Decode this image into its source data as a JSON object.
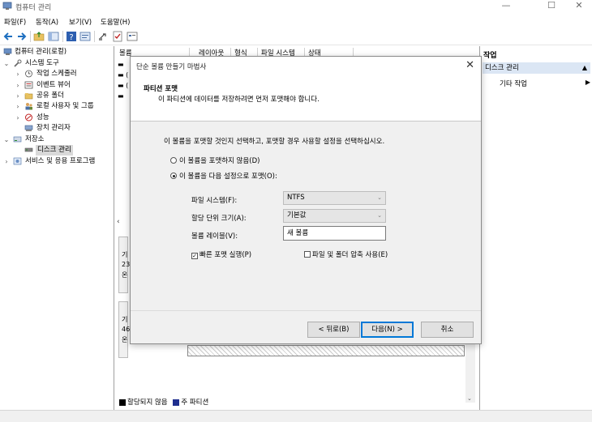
{
  "window": {
    "title": "컴퓨터 관리",
    "minimize": "—",
    "maximize": "☐",
    "close": "✕"
  },
  "menu": [
    "파일(F)",
    "동작(A)",
    "보기(V)",
    "도움말(H)"
  ],
  "toolbar_icons": [
    "back-icon",
    "forward-icon",
    "folder-up-icon",
    "show-tree-icon",
    "help-icon",
    "properties-icon",
    "connect-icon",
    "checklist-icon",
    "view-icon"
  ],
  "tree": {
    "root": "컴퓨터 관리(로컬)",
    "system_tools": "시스템 도구",
    "task_scheduler": "작업 스케줄러",
    "event_viewer": "이벤트 뷰어",
    "shared_folders": "공유 폴더",
    "local_users": "로컬 사용자 및 그룹",
    "performance": "성능",
    "device_manager": "장치 관리자",
    "storage": "저장소",
    "disk_management": "디스크 관리",
    "services": "서비스 및 응용 프로그램"
  },
  "columns": [
    "볼륨",
    "레이아웃",
    "형식",
    "파일 시스템",
    "상태"
  ],
  "legend": {
    "unallocated": "할당되지 않음",
    "primary": "주 파티션"
  },
  "disk_labels": [
    "기",
    "23",
    "온",
    "기",
    "46",
    "온"
  ],
  "actions": {
    "header": "작업",
    "section": "디스크 관리",
    "more": "기타 작업"
  },
  "dialog": {
    "title": "단순 볼륨 만들기 마법사",
    "header_title": "파티션 포맷",
    "header_sub": "이 파티션에 데이터를 저장하려면 먼저 포맷해야 합니다.",
    "instruction": "이 볼륨을 포맷할 것인지 선택하고, 포맷할 경우 사용할 설정을 선택하십시오.",
    "radio_no_format": "이 볼륨을 포맷하지 않음(D)",
    "radio_format": "이 볼륨을 다음 설정으로 포맷(O):",
    "fs_label": "파일 시스템(F):",
    "fs_value": "NTFS",
    "alloc_label": "할당 단위 크기(A):",
    "alloc_value": "기본값",
    "vol_label": "볼륨 레이블(V):",
    "vol_value": "새 볼륨",
    "quick_format": "빠른 포맷 실행(P)",
    "compression": "파일 및 폴더 압축 사용(E)",
    "back": "< 뒤로(B)",
    "next": "다음(N) >",
    "cancel": "취소"
  },
  "colors": {
    "selection": "#dbe6f4",
    "primary_partition": "#1f2f8f",
    "unallocated": "#000000",
    "focus": "#0078d7"
  }
}
